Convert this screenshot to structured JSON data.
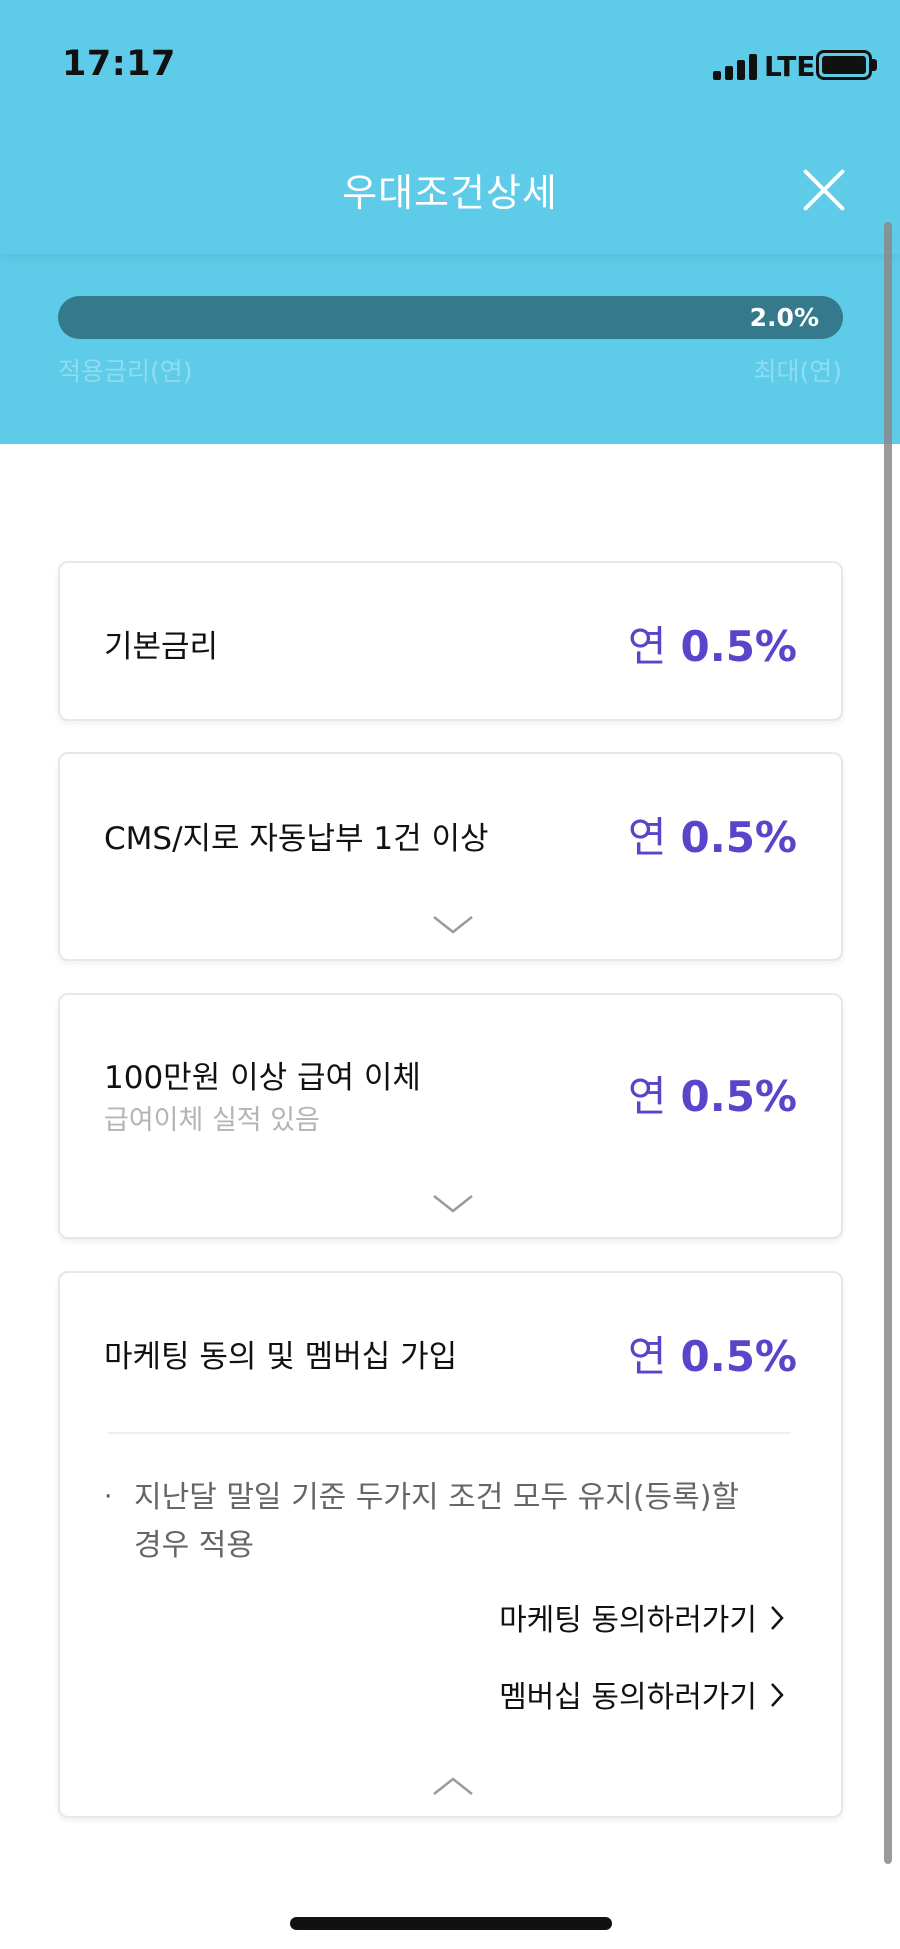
{
  "status": {
    "time": "17:17",
    "network": "LTE"
  },
  "header": {
    "title": "우대조건상세"
  },
  "progress": {
    "value_label": "2.0%",
    "fill_fraction": 1.0,
    "left_label": "적용금리(연)",
    "right_label": "최대(연)"
  },
  "cards": [
    {
      "title": "기본금리",
      "rate_prefix": "연",
      "rate_value": "0.5%"
    },
    {
      "title": "CMS/지로 자동납부 1건 이상",
      "rate_prefix": "연",
      "rate_value": "0.5%"
    },
    {
      "title": "100만원 이상 급여 이체",
      "subtitle": "급여이체 실적 있음",
      "rate_prefix": "연",
      "rate_value": "0.5%"
    },
    {
      "title": "마케팅 동의 및 멤버십 가입",
      "rate_prefix": "연",
      "rate_value": "0.5%",
      "bullet": "·",
      "note": "지난달 말일 기준 두가지 조건 모두 유지(등록)할 경우 적용",
      "links": [
        "마케팅 동의하러가기",
        "멤버십 동의하러가기"
      ]
    }
  ],
  "colors": {
    "header_bg": "#5ecbe9",
    "progress_fill": "#357a8c",
    "rate_accent": "#5a44c9"
  }
}
